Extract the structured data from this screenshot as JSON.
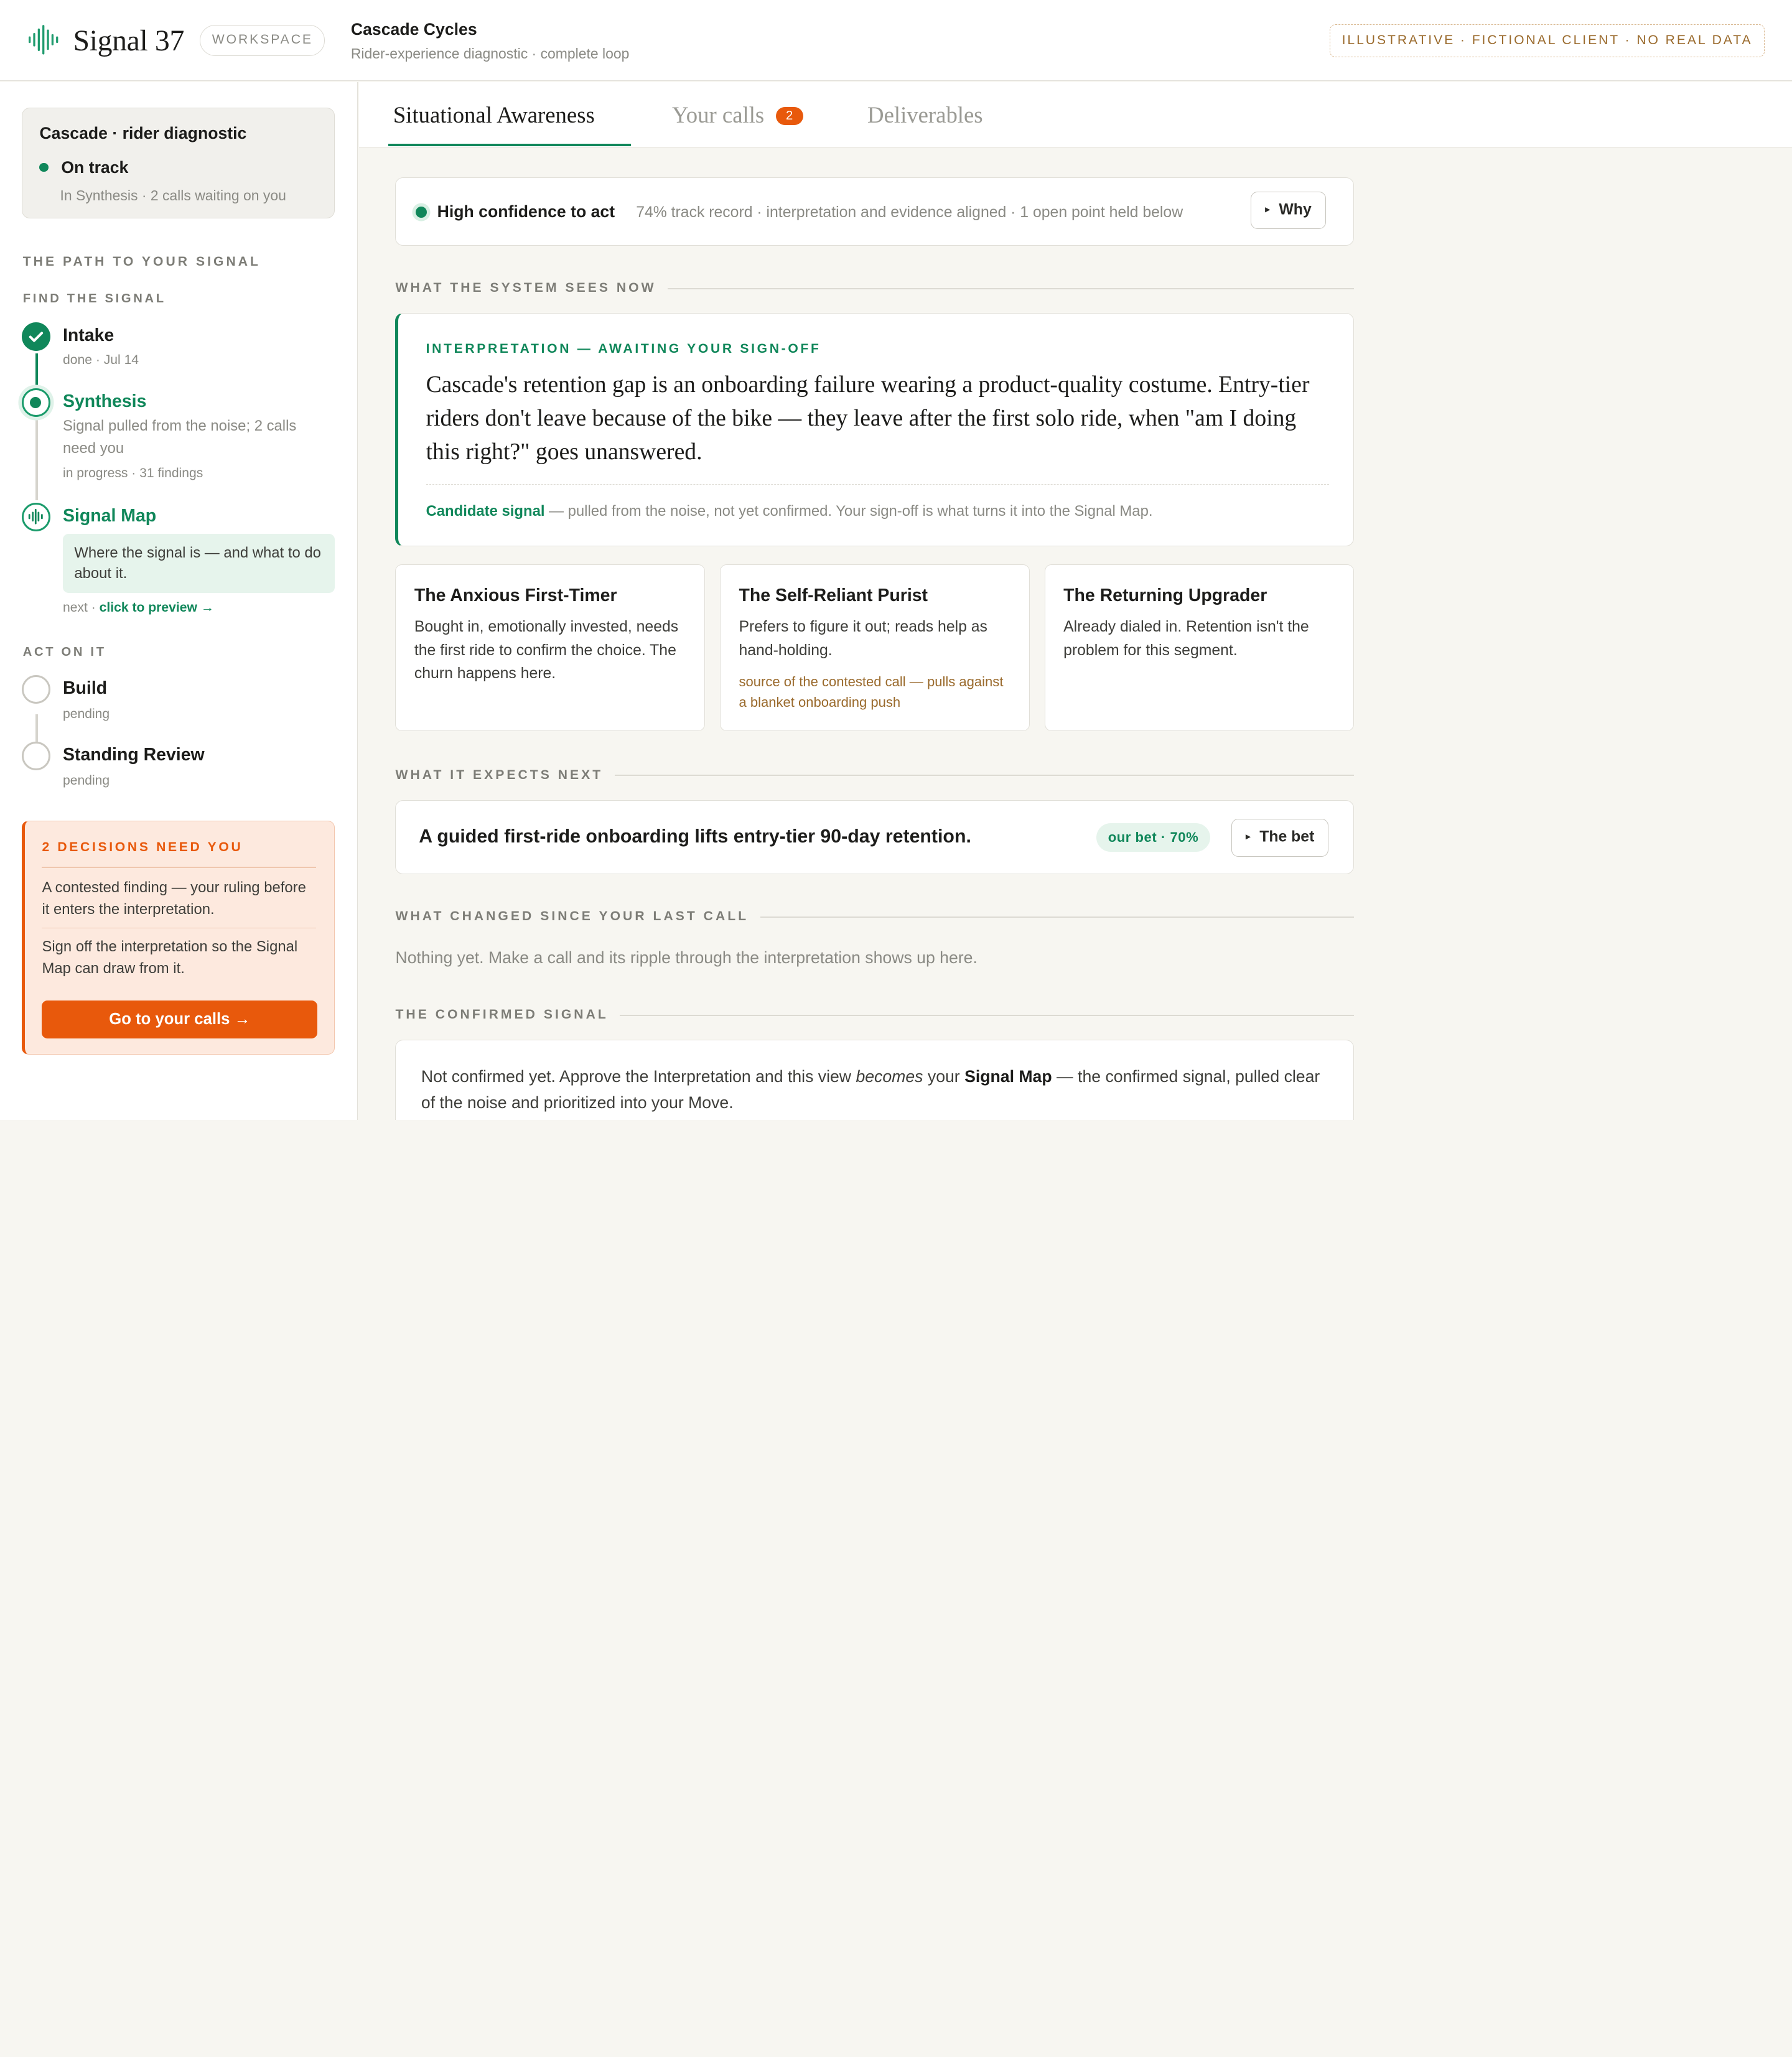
{
  "topbar": {
    "brand": "Signal 37",
    "workspace_label": "WORKSPACE",
    "client_name": "Cascade Cycles",
    "client_sub": "Rider-experience diagnostic · complete loop",
    "disclaimer": "ILLUSTRATIVE · FICTIONAL CLIENT · NO REAL DATA"
  },
  "sidebar": {
    "project_title": "Cascade · rider diagnostic",
    "project_status": "On track",
    "project_sub": "In Synthesis · 2 calls waiting on you",
    "path_heading": "THE PATH TO YOUR SIGNAL",
    "find_heading": "FIND THE SIGNAL",
    "act_heading": "ACT ON IT",
    "steps": [
      {
        "name": "Intake",
        "meta": "done · Jul 14"
      },
      {
        "name": "Synthesis",
        "desc": "Signal pulled from the noise; 2 calls need you",
        "meta": "in progress · 31 findings"
      },
      {
        "name": "Signal Map",
        "preview": "Where the signal is — and what to do about it.",
        "next_prefix": "next · ",
        "next_link": "click to preview →"
      },
      {
        "name": "Build",
        "meta": "pending"
      },
      {
        "name": "Standing Review",
        "meta": "pending"
      }
    ],
    "decisions": {
      "title": "2 DECISIONS NEED YOU",
      "items": [
        "A contested finding — your ruling before it enters the interpretation.",
        "Sign off the interpretation so the Signal Map can draw from it."
      ],
      "button": "Go to your calls →"
    }
  },
  "tabs": [
    {
      "label": "Situational Awareness"
    },
    {
      "label": "Your calls",
      "badge": "2"
    },
    {
      "label": "Deliverables"
    }
  ],
  "confidence": {
    "label": "High confidence to act",
    "detail": "74% track record · interpretation and evidence aligned · 1 open point held below",
    "button": "Why"
  },
  "sections": {
    "sees_now": "WHAT THE SYSTEM SEES NOW",
    "expects_next": "WHAT IT EXPECTS NEXT",
    "changed": "WHAT CHANGED SINCE YOUR LAST CALL",
    "confirmed": "THE CONFIRMED SIGNAL"
  },
  "interpretation": {
    "heading": "INTERPRETATION — AWAITING YOUR SIGN-OFF",
    "text": "Cascade's retention gap is an onboarding failure wearing a product-quality costume. Entry-tier riders don't leave because of the bike — they leave after the first solo ride, when \"am I doing this right?\" goes unanswered.",
    "foot_label": "Candidate signal",
    "foot_text": " — pulled from the noise, not yet confirmed. Your sign-off is what turns it into the Signal Map."
  },
  "segments": [
    {
      "title": "The Anxious First-Timer",
      "desc": "Bought in, emotionally invested, needs the first ride to confirm the choice. The churn happens here."
    },
    {
      "title": "The Self-Reliant Purist",
      "desc": "Prefers to figure it out; reads help as hand-holding.",
      "note": "source of the contested call — pulls against a blanket onboarding push"
    },
    {
      "title": "The Returning Upgrader",
      "desc": "Already dialed in. Retention isn't the problem for this segment."
    }
  ],
  "bet": {
    "text": "A guided first-ride onboarding lifts entry-tier 90-day retention.",
    "pill": "our bet · 70%",
    "button": "The bet"
  },
  "changed_text": "Nothing yet. Make a call and its ripple through the interpretation shows up here.",
  "confirmed": {
    "part1": "Not confirmed yet. Approve the Interpretation and this view ",
    "em": "becomes",
    "part2": " your ",
    "strong": "Signal Map",
    "part3": " — the confirmed signal, pulled clear of the noise and prioritized into your Move."
  }
}
